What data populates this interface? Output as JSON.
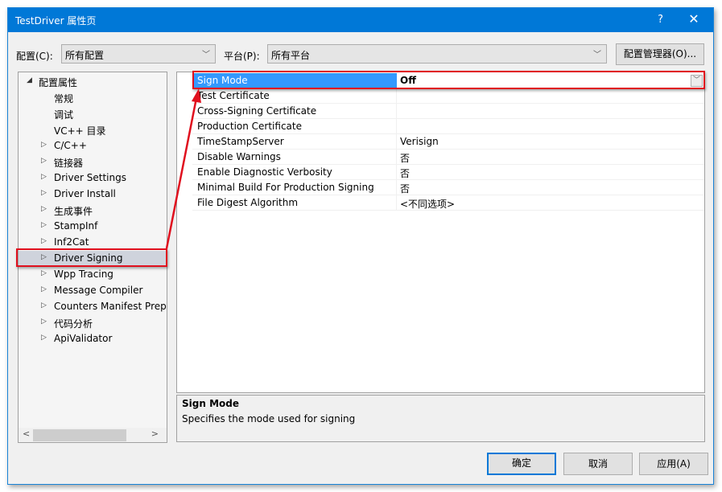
{
  "window": {
    "title": "TestDriver 属性页",
    "help_glyph": "?",
    "close_glyph": "✕"
  },
  "config_bar": {
    "config_label": "配置(C):",
    "config_value": "所有配置",
    "platform_label": "平台(P):",
    "platform_value": "所有平台",
    "manager_button": "配置管理器(O)...",
    "dropdown_glyph": "﹀"
  },
  "tree": {
    "items": [
      {
        "label": "配置属性",
        "expander": "◢",
        "level": 0,
        "state": "expanded"
      },
      {
        "label": "常规",
        "expander": "",
        "level": 1
      },
      {
        "label": "调试",
        "expander": "",
        "level": 1
      },
      {
        "label": "VC++ 目录",
        "expander": "",
        "level": 1
      },
      {
        "label": "C/C++",
        "expander": "▷",
        "level": 1
      },
      {
        "label": "链接器",
        "expander": "▷",
        "level": 1
      },
      {
        "label": "Driver Settings",
        "expander": "▷",
        "level": 1
      },
      {
        "label": "Driver Install",
        "expander": "▷",
        "level": 1
      },
      {
        "label": "生成事件",
        "expander": "▷",
        "level": 1
      },
      {
        "label": "StampInf",
        "expander": "▷",
        "level": 1
      },
      {
        "label": "Inf2Cat",
        "expander": "▷",
        "level": 1
      },
      {
        "label": "Driver Signing",
        "expander": "▷",
        "level": 1,
        "selected": true
      },
      {
        "label": "Wpp Tracing",
        "expander": "▷",
        "level": 1
      },
      {
        "label": "Message Compiler",
        "expander": "▷",
        "level": 1
      },
      {
        "label": "Counters Manifest Preprocessor",
        "expander": "▷",
        "level": 1
      },
      {
        "label": "代码分析",
        "expander": "▷",
        "level": 1
      },
      {
        "label": "ApiValidator",
        "expander": "▷",
        "level": 1
      }
    ],
    "scroll_left": "<",
    "scroll_right": ">"
  },
  "properties": {
    "rows": [
      {
        "name": "Sign Mode",
        "value": "Off",
        "selected": true
      },
      {
        "name": "Test Certificate",
        "value": ""
      },
      {
        "name": "Cross-Signing Certificate",
        "value": ""
      },
      {
        "name": "Production Certificate",
        "value": ""
      },
      {
        "name": "TimeStampServer",
        "value": "Verisign"
      },
      {
        "name": "Disable Warnings",
        "value": "否"
      },
      {
        "name": "Enable Diagnostic Verbosity",
        "value": "否"
      },
      {
        "name": "Minimal Build For Production Signing",
        "value": "否"
      },
      {
        "name": "File Digest Algorithm",
        "value": "<不同选项>"
      }
    ],
    "dropdown_glyph": "﹀"
  },
  "description": {
    "title": "Sign Mode",
    "text": "Specifies the mode used for signing"
  },
  "buttons": {
    "ok": "确定",
    "cancel": "取消",
    "apply": "应用(A)"
  },
  "annotation": {
    "color": "#e0101e"
  }
}
